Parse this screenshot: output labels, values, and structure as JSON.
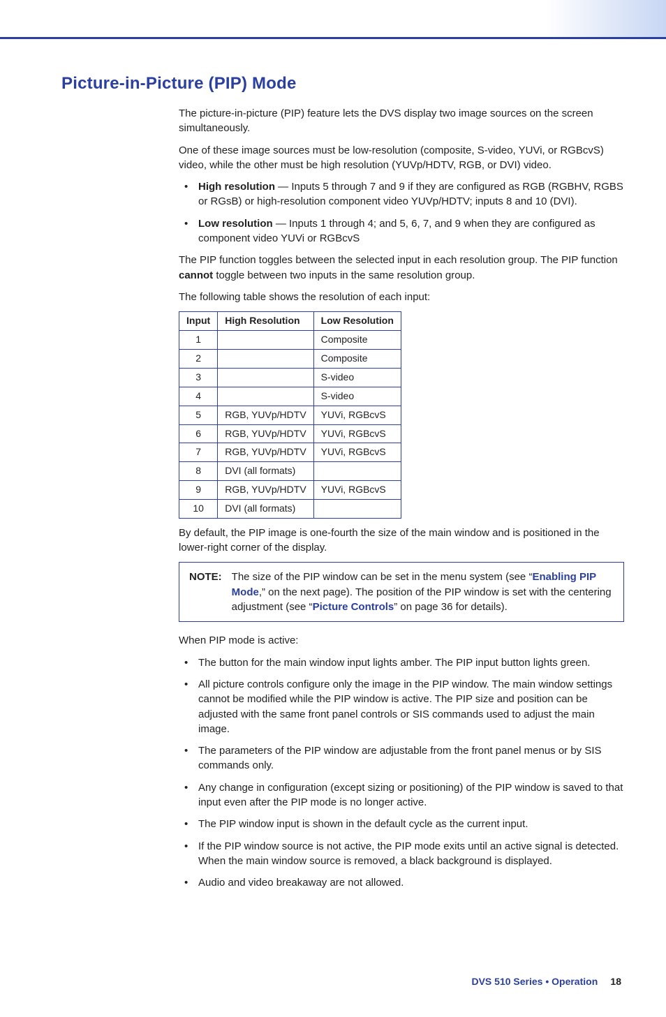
{
  "heading": "Picture-in-Picture (PIP) Mode",
  "intro1": "The picture-in-picture (PIP) feature lets the DVS display two image sources on the screen simultaneously.",
  "intro2": "One of these image sources must be low-resolution (composite, S-video, YUVi, or RGBcvS) video, while the other must be high resolution (YUVp/HDTV, RGB, or DVI) video.",
  "def_hr_label": "High resolution",
  "def_hr_text": " — Inputs 5 through 7 and 9 if they are configured as RGB (RGBHV, RGBS or RGsB) or high-resolution component video YUVp/HDTV; inputs 8 and 10 (DVI).",
  "def_lr_label": "Low resolution",
  "def_lr_text": " — Inputs 1 through 4; and 5, 6, 7, and 9 when they are configured as component video YUVi or RGBcvS",
  "toggle1a": "The PIP function toggles between the selected input in each resolution group. The PIP function ",
  "toggle1b": "cannot",
  "toggle1c": " toggle between two inputs in the same resolution group.",
  "table_intro": "The following table shows the resolution of each input:",
  "table": {
    "h1": "Input",
    "h2": "High Resolution",
    "h3": "Low Resolution",
    "rows": [
      {
        "i": "1",
        "hr": "",
        "lr": "Composite"
      },
      {
        "i": "2",
        "hr": "",
        "lr": "Composite"
      },
      {
        "i": "3",
        "hr": "",
        "lr": "S-video"
      },
      {
        "i": "4",
        "hr": "",
        "lr": "S-video"
      },
      {
        "i": "5",
        "hr": "RGB, YUVp/HDTV",
        "lr": "YUVi, RGBcvS"
      },
      {
        "i": "6",
        "hr": "RGB, YUVp/HDTV",
        "lr": "YUVi, RGBcvS"
      },
      {
        "i": "7",
        "hr": "RGB, YUVp/HDTV",
        "lr": "YUVi, RGBcvS"
      },
      {
        "i": "8",
        "hr": "DVI (all formats)",
        "lr": ""
      },
      {
        "i": "9",
        "hr": "RGB, YUVp/HDTV",
        "lr": "YUVi, RGBcvS"
      },
      {
        "i": "10",
        "hr": "DVI (all formats)",
        "lr": ""
      }
    ]
  },
  "after_table": "By default, the PIP image is one-fourth the size of the main window and is positioned in the lower-right corner of the display.",
  "note_label": "NOTE:",
  "note_a": "The size of the PIP window can be set in the menu system (see “",
  "note_link1": "Enabling PIP Mode",
  "note_b": ",” on the next page). The position of the PIP window is set with the centering adjustment (see “",
  "note_link2": "Picture Controls",
  "note_c": "” on page 36 for details).",
  "when_active": "When PIP mode is active:",
  "bul": {
    "0": "The button for the main window input lights amber. The PIP input button lights green.",
    "1": "All picture controls configure only the image in the PIP window. The main window settings cannot be modified while the PIP window is active. The PIP size and position can be adjusted with the same front panel controls or SIS commands used to adjust the main image.",
    "2": "The parameters of the PIP window are adjustable from the front panel menus or by SIS commands only.",
    "3": "Any change in configuration (except sizing or positioning) of the PIP window is saved to that input even after the PIP mode is no longer active.",
    "4": "The PIP window input is shown in the default cycle as the current input.",
    "5": "If the PIP window source is not active, the PIP mode exits until an active signal is detected. When the main window source is removed, a black background is displayed.",
    "6": "Audio and video breakaway are not allowed."
  },
  "footer_title": "DVS 510 Series • Operation",
  "footer_page": "18"
}
